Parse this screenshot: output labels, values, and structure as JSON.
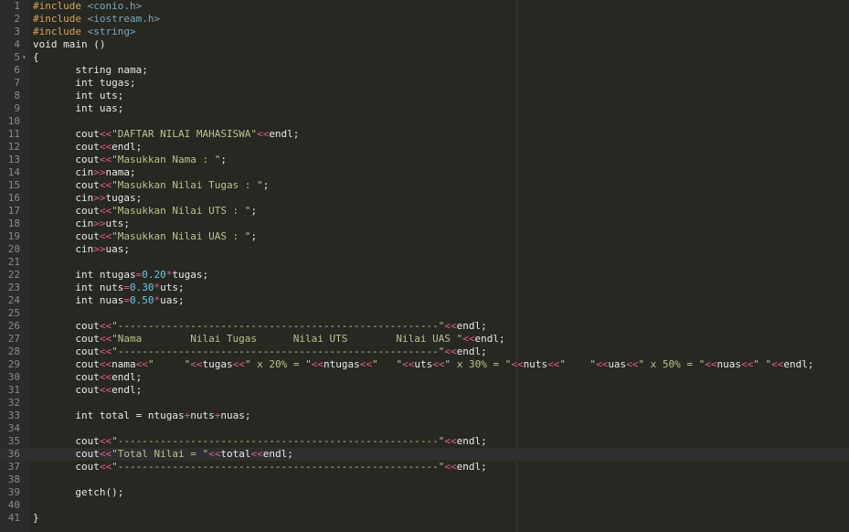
{
  "editor": {
    "active_line": 36,
    "colors": {
      "background": "#272822",
      "gutter": "#2b2b2b",
      "keyword": "#e8e8e8",
      "preprocessor": "#d6a15c",
      "include_path": "#7fa7b8",
      "string": "#b5c48a",
      "operator": "#e25d87",
      "number": "#6cc7e8"
    },
    "lines": [
      {
        "n": "1",
        "fold": "",
        "tokens": [
          [
            "pp",
            "#include "
          ],
          [
            "inc",
            "<conio.h>"
          ]
        ]
      },
      {
        "n": "2",
        "fold": "",
        "tokens": [
          [
            "pp",
            "#include "
          ],
          [
            "inc",
            "<iostream.h>"
          ]
        ]
      },
      {
        "n": "3",
        "fold": "",
        "tokens": [
          [
            "pp",
            "#include "
          ],
          [
            "inc",
            "<string>"
          ]
        ]
      },
      {
        "n": "4",
        "fold": "",
        "tokens": [
          [
            "plain",
            "void main ()"
          ]
        ]
      },
      {
        "n": "5",
        "fold": "▾",
        "tokens": [
          [
            "plain",
            "{"
          ]
        ]
      },
      {
        "n": "6",
        "fold": "",
        "tokens": [
          [
            "plain",
            "       string nama;"
          ]
        ]
      },
      {
        "n": "7",
        "fold": "",
        "tokens": [
          [
            "plain",
            "       int tugas;"
          ]
        ]
      },
      {
        "n": "8",
        "fold": "",
        "tokens": [
          [
            "plain",
            "       int uts;"
          ]
        ]
      },
      {
        "n": "9",
        "fold": "",
        "tokens": [
          [
            "plain",
            "       int uas;"
          ]
        ]
      },
      {
        "n": "10",
        "fold": "",
        "tokens": []
      },
      {
        "n": "11",
        "fold": "",
        "tokens": [
          [
            "plain",
            "       cout"
          ],
          [
            "op",
            "<<"
          ],
          [
            "str",
            "\"DAFTAR NILAI MAHASISWA\""
          ],
          [
            "op",
            "<<"
          ],
          [
            "plain",
            "endl;"
          ]
        ]
      },
      {
        "n": "12",
        "fold": "",
        "tokens": [
          [
            "plain",
            "       cout"
          ],
          [
            "op",
            "<<"
          ],
          [
            "plain",
            "endl;"
          ]
        ]
      },
      {
        "n": "13",
        "fold": "",
        "tokens": [
          [
            "plain",
            "       cout"
          ],
          [
            "op",
            "<<"
          ],
          [
            "str",
            "\"Masukkan Nama : \""
          ],
          [
            "plain",
            ";"
          ]
        ]
      },
      {
        "n": "14",
        "fold": "",
        "tokens": [
          [
            "plain",
            "       cin"
          ],
          [
            "op",
            ">>"
          ],
          [
            "plain",
            "nama;"
          ]
        ]
      },
      {
        "n": "15",
        "fold": "",
        "tokens": [
          [
            "plain",
            "       cout"
          ],
          [
            "op",
            "<<"
          ],
          [
            "str",
            "\"Masukkan Nilai Tugas : \""
          ],
          [
            "plain",
            ";"
          ]
        ]
      },
      {
        "n": "16",
        "fold": "",
        "tokens": [
          [
            "plain",
            "       cin"
          ],
          [
            "op",
            ">>"
          ],
          [
            "plain",
            "tugas;"
          ]
        ]
      },
      {
        "n": "17",
        "fold": "",
        "tokens": [
          [
            "plain",
            "       cout"
          ],
          [
            "op",
            "<<"
          ],
          [
            "str",
            "\"Masukkan Nilai UTS : \""
          ],
          [
            "plain",
            ";"
          ]
        ]
      },
      {
        "n": "18",
        "fold": "",
        "tokens": [
          [
            "plain",
            "       cin"
          ],
          [
            "op",
            ">>"
          ],
          [
            "plain",
            "uts;"
          ]
        ]
      },
      {
        "n": "19",
        "fold": "",
        "tokens": [
          [
            "plain",
            "       cout"
          ],
          [
            "op",
            "<<"
          ],
          [
            "str",
            "\"Masukkan Nilai UAS : \""
          ],
          [
            "plain",
            ";"
          ]
        ]
      },
      {
        "n": "20",
        "fold": "",
        "tokens": [
          [
            "plain",
            "       cin"
          ],
          [
            "op",
            ">>"
          ],
          [
            "plain",
            "uas;"
          ]
        ]
      },
      {
        "n": "21",
        "fold": "",
        "tokens": []
      },
      {
        "n": "22",
        "fold": "",
        "tokens": [
          [
            "plain",
            "       int ntugas"
          ],
          [
            "op",
            "="
          ],
          [
            "num",
            "0.20"
          ],
          [
            "op",
            "*"
          ],
          [
            "plain",
            "tugas;"
          ]
        ]
      },
      {
        "n": "23",
        "fold": "",
        "tokens": [
          [
            "plain",
            "       int nuts"
          ],
          [
            "op",
            "="
          ],
          [
            "num",
            "0.30"
          ],
          [
            "op",
            "*"
          ],
          [
            "plain",
            "uts;"
          ]
        ]
      },
      {
        "n": "24",
        "fold": "",
        "tokens": [
          [
            "plain",
            "       int nuas"
          ],
          [
            "op",
            "="
          ],
          [
            "num",
            "0.50"
          ],
          [
            "op",
            "*"
          ],
          [
            "plain",
            "uas;"
          ]
        ]
      },
      {
        "n": "25",
        "fold": "",
        "tokens": []
      },
      {
        "n": "26",
        "fold": "",
        "tokens": [
          [
            "plain",
            "       cout"
          ],
          [
            "op",
            "<<"
          ],
          [
            "str",
            "\"-----------------------------------------------------\""
          ],
          [
            "op",
            "<<"
          ],
          [
            "plain",
            "endl;"
          ]
        ]
      },
      {
        "n": "27",
        "fold": "",
        "tokens": [
          [
            "plain",
            "       cout"
          ],
          [
            "op",
            "<<"
          ],
          [
            "str",
            "\"Nama        Nilai Tugas      Nilai UTS        Nilai UAS \""
          ],
          [
            "op",
            "<<"
          ],
          [
            "plain",
            "endl;"
          ]
        ]
      },
      {
        "n": "28",
        "fold": "",
        "tokens": [
          [
            "plain",
            "       cout"
          ],
          [
            "op",
            "<<"
          ],
          [
            "str",
            "\"-----------------------------------------------------\""
          ],
          [
            "op",
            "<<"
          ],
          [
            "plain",
            "endl;"
          ]
        ]
      },
      {
        "n": "29",
        "fold": "",
        "tokens": [
          [
            "plain",
            "       cout"
          ],
          [
            "op",
            "<<"
          ],
          [
            "plain",
            "nama"
          ],
          [
            "op",
            "<<"
          ],
          [
            "str",
            "\"     \""
          ],
          [
            "op",
            "<<"
          ],
          [
            "plain",
            "tugas"
          ],
          [
            "op",
            "<<"
          ],
          [
            "str",
            "\" x 20% = \""
          ],
          [
            "op",
            "<<"
          ],
          [
            "plain",
            "ntugas"
          ],
          [
            "op",
            "<<"
          ],
          [
            "str",
            "\"   \""
          ],
          [
            "op",
            "<<"
          ],
          [
            "plain",
            "uts"
          ],
          [
            "op",
            "<<"
          ],
          [
            "str",
            "\" x 30% = \""
          ],
          [
            "op",
            "<<"
          ],
          [
            "plain",
            "nuts"
          ],
          [
            "op",
            "<<"
          ],
          [
            "str",
            "\"    \""
          ],
          [
            "op",
            "<<"
          ],
          [
            "plain",
            "uas"
          ],
          [
            "op",
            "<<"
          ],
          [
            "str",
            "\" x 50% = \""
          ],
          [
            "op",
            "<<"
          ],
          [
            "plain",
            "nuas"
          ],
          [
            "op",
            "<<"
          ],
          [
            "str",
            "\" \""
          ],
          [
            "op",
            "<<"
          ],
          [
            "plain",
            "endl;"
          ]
        ]
      },
      {
        "n": "30",
        "fold": "",
        "tokens": [
          [
            "plain",
            "       cout"
          ],
          [
            "op",
            "<<"
          ],
          [
            "plain",
            "endl;"
          ]
        ]
      },
      {
        "n": "31",
        "fold": "",
        "tokens": [
          [
            "plain",
            "       cout"
          ],
          [
            "op",
            "<<"
          ],
          [
            "plain",
            "endl;"
          ]
        ]
      },
      {
        "n": "32",
        "fold": "",
        "tokens": []
      },
      {
        "n": "33",
        "fold": "",
        "tokens": [
          [
            "plain",
            "       int total = ntugas"
          ],
          [
            "op",
            "+"
          ],
          [
            "plain",
            "nuts"
          ],
          [
            "op",
            "+"
          ],
          [
            "plain",
            "nuas;"
          ]
        ]
      },
      {
        "n": "34",
        "fold": "",
        "tokens": []
      },
      {
        "n": "35",
        "fold": "",
        "tokens": [
          [
            "plain",
            "       cout"
          ],
          [
            "op",
            "<<"
          ],
          [
            "str",
            "\"-----------------------------------------------------\""
          ],
          [
            "op",
            "<<"
          ],
          [
            "plain",
            "endl;"
          ]
        ]
      },
      {
        "n": "36",
        "fold": "",
        "tokens": [
          [
            "plain",
            "       cout"
          ],
          [
            "op",
            "<<"
          ],
          [
            "str",
            "\"Total Nilai = \""
          ],
          [
            "op",
            "<<"
          ],
          [
            "plain",
            "total"
          ],
          [
            "op",
            "<<"
          ],
          [
            "plain",
            "endl;"
          ]
        ]
      },
      {
        "n": "37",
        "fold": "",
        "tokens": [
          [
            "plain",
            "       cout"
          ],
          [
            "op",
            "<<"
          ],
          [
            "str",
            "\"-----------------------------------------------------\""
          ],
          [
            "op",
            "<<"
          ],
          [
            "plain",
            "endl;"
          ]
        ]
      },
      {
        "n": "38",
        "fold": "",
        "tokens": []
      },
      {
        "n": "39",
        "fold": "",
        "tokens": [
          [
            "plain",
            "       getch();"
          ]
        ]
      },
      {
        "n": "40",
        "fold": "",
        "tokens": []
      },
      {
        "n": "41",
        "fold": "",
        "tokens": [
          [
            "plain",
            "}"
          ]
        ]
      }
    ]
  }
}
